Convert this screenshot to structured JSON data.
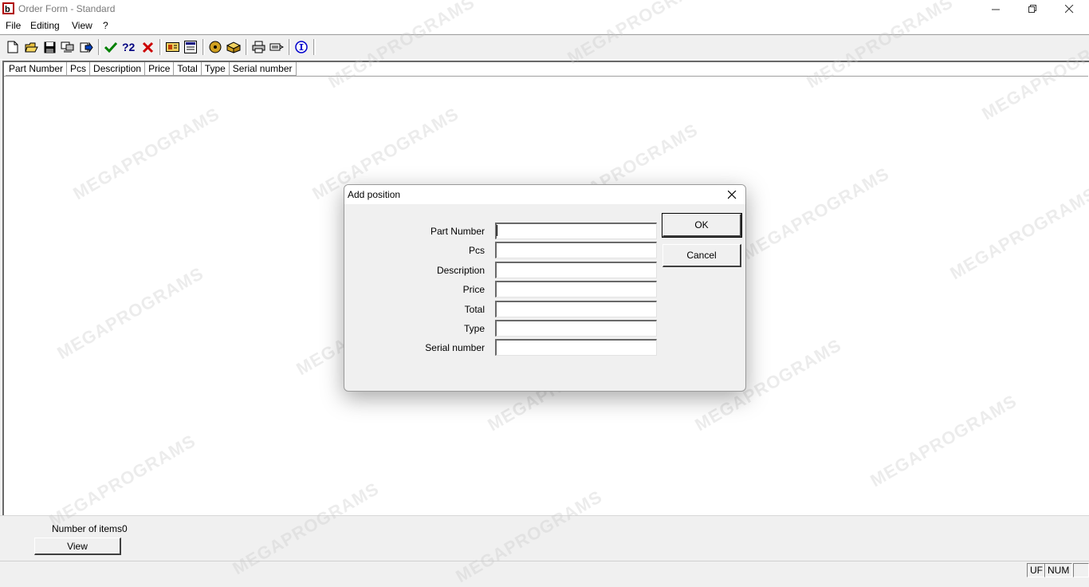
{
  "window": {
    "title": "Order Form - Standard",
    "minimize_icon": "minimize-icon",
    "maximize_icon": "restore-icon",
    "close_icon": "close-icon"
  },
  "menu": {
    "items": [
      "File",
      "Editing",
      "View",
      "?"
    ]
  },
  "toolbar": {
    "icons": [
      "new-document-icon",
      "open-folder-icon",
      "save-icon",
      "computer-icon",
      "export-arrow-icon",
      "checkmark-icon",
      "renumber-icon",
      "delete-x-icon",
      "card-icon",
      "form-icon",
      "disk-icon",
      "package-icon",
      "printer-icon",
      "print-preview-icon",
      "info-icon"
    ]
  },
  "list": {
    "columns": [
      "Part Number",
      "Pcs",
      "Description",
      "Price",
      "Total",
      "Type",
      "Serial number"
    ]
  },
  "bottom": {
    "items_label": "Number of items",
    "items_count": "0",
    "view_button": "View"
  },
  "status": {
    "cell1": "UF",
    "cell2": "NUM"
  },
  "dialog": {
    "title": "Add position",
    "fields": [
      {
        "label": "Part Number",
        "value": ""
      },
      {
        "label": "Pcs",
        "value": ""
      },
      {
        "label": "Description",
        "value": ""
      },
      {
        "label": "Price",
        "value": ""
      },
      {
        "label": "Total",
        "value": ""
      },
      {
        "label": "Type",
        "value": ""
      },
      {
        "label": "Serial number",
        "value": ""
      }
    ],
    "ok_button": "OK",
    "cancel_button": "Cancel"
  },
  "watermark": "MEGAPROGRAMS",
  "colors": {
    "title_text": "#7a7a7a",
    "check_green": "#008000",
    "delete_red": "#cc0000",
    "info_blue": "#0000cc"
  }
}
